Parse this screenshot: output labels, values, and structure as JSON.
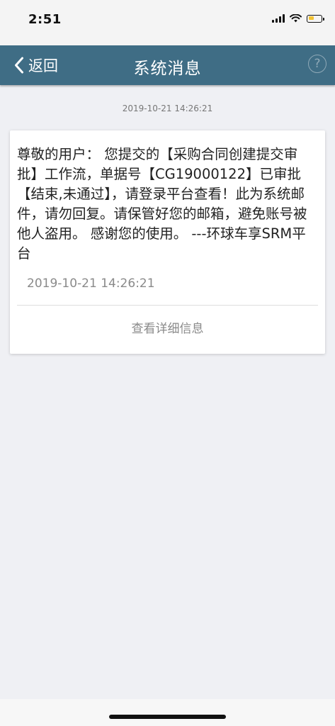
{
  "status_bar": {
    "time": "2:51",
    "battery_level": 0.45,
    "icons": [
      "signal-icon",
      "wifi-icon",
      "battery-icon"
    ]
  },
  "navbar": {
    "back_label": "返回",
    "title": "系统消息",
    "help_glyph": "?"
  },
  "message": {
    "header_time": "2019-10-21 14:26:21",
    "body": "尊敬的用户： 您提交的【采购合同创建提交审批】工作流，单据号【CG19000122】已审批【结束,未通过】，请登录平台查看！此为系统邮件，请勿回复。请保管好您的邮箱，避免账号被他人盗用。 感谢您的使用。 ---环球车享SRM平台",
    "time": "2019-10-21 14:26:21",
    "detail_label": "查看详细信息"
  },
  "colors": {
    "navbar": "#3f6d85",
    "background": "#eff0f4",
    "battery": "#f2c230"
  }
}
